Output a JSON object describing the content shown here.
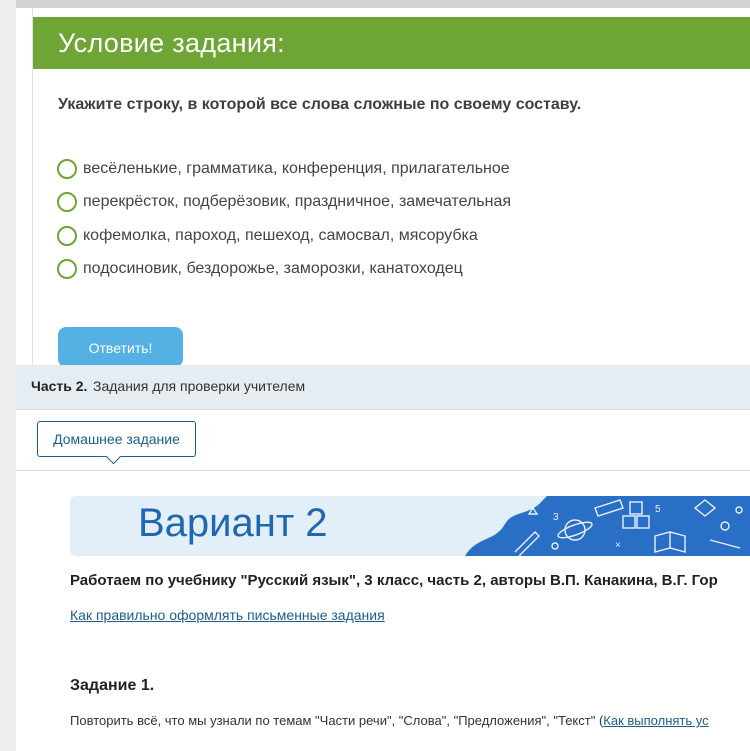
{
  "task": {
    "header": "Условие задания:",
    "question": "Укажите строку, в которой все слова сложные по своему составу.",
    "options": [
      "весёленькие, грамматика, конференция, прилагательное",
      "перекрёсток, подберёзовик, праздничное, замечательная",
      "кофемолка, пароход, пешеход, самосвал, мясорубка",
      "подосиновик, бездорожье, заморозки, канатоходец"
    ],
    "answer_button": "Ответить!"
  },
  "part2": {
    "label_bold": "Часть 2.",
    "label_rest": "Задания для проверки учителем"
  },
  "homework_tab": "Домашнее задание",
  "banner": {
    "title": "Вариант 2"
  },
  "content": {
    "textbook": "Работаем по учебнику \"Русский язык\", 3 класс, часть 2, авторы В.П. Канакина, В.Г. Гор",
    "howto_link": "Как правильно оформлять письменные задания",
    "task1_title": "Задание 1.",
    "task1_text": "Повторить всё, что мы узнали по темам \"Части речи\", \"Слова\", \"Предложения\", \"Текст\" (",
    "task1_link": "Как выполнять ус"
  },
  "colors": {
    "header_green": "#6ea534",
    "button_blue": "#55b1e4",
    "link_blue": "#1c5e8c",
    "banner_blue": "#1f67b2"
  },
  "icons": [
    "radio-unchecked-icon",
    "planet-icon",
    "book-icon",
    "abc-blocks-icon",
    "ruler-icon",
    "pencil-icon"
  ]
}
